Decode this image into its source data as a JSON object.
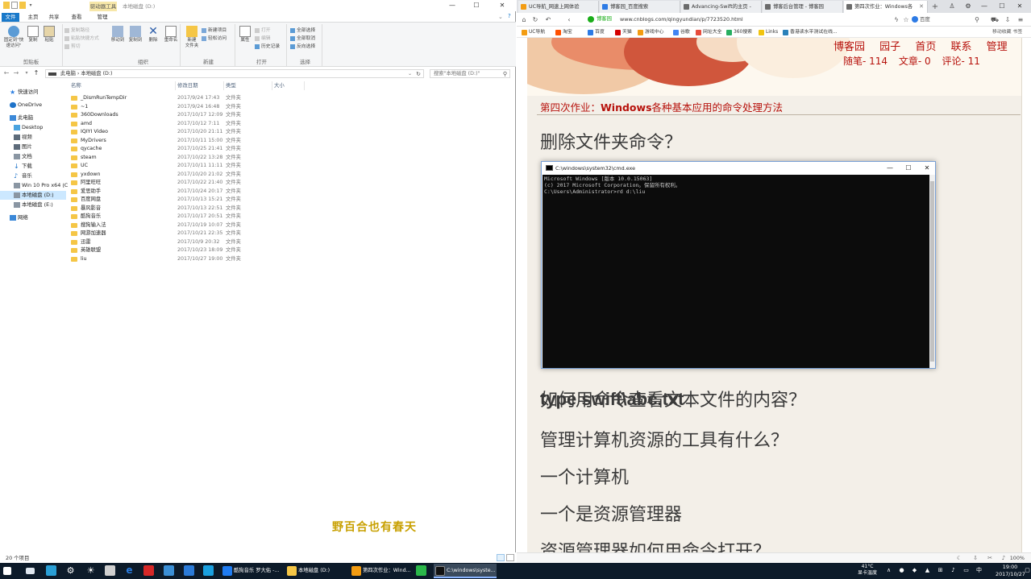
{
  "explorer": {
    "context_tab": "驱动器工具",
    "title": "本地磁盘 (D:)",
    "ribbon_tabs": [
      "文件",
      "主页",
      "共享",
      "查看",
      "管理"
    ],
    "ribbon": {
      "pin_label": "固定到\"快速访问\"",
      "copy_label": "复制",
      "paste_label": "粘贴",
      "copy_path": "复制路径",
      "paste_shortcut": "粘贴快捷方式",
      "cut": "剪切",
      "clipboard_group": "剪贴板",
      "move_to": "移动到",
      "copy_to": "复制到",
      "delete": "删除",
      "rename": "重命名",
      "organize_group": "组织",
      "new_folder": "新建\n文件夹",
      "new_item": "新建项目",
      "easy_access": "轻松访问",
      "new_group": "新建",
      "properties": "属性",
      "open": "打开",
      "edit": "编辑",
      "history": "历史记录",
      "open_group": "打开",
      "select_all": "全部选择",
      "select_none": "全部取消",
      "invert": "反向选择",
      "select_group": "选择"
    },
    "address": {
      "crumbs": "此电脑 › 本地磁盘 (D:)",
      "search_placeholder": "搜索\"本地磁盘 (D:)\""
    },
    "nav": {
      "quick_access": "快速访问",
      "onedrive": "OneDrive",
      "this_pc": "此电脑",
      "desktop": "Desktop",
      "videos": "视频",
      "pictures": "图片",
      "documents": "文档",
      "downloads": "下载",
      "music": "音乐",
      "drive_c": "Win 10 Pro x64 (C",
      "drive_d": "本地磁盘 (D:)",
      "drive_e": "本地磁盘 (E:)",
      "network": "网络"
    },
    "columns": [
      "名称",
      "修改日期",
      "类型",
      "大小"
    ],
    "files": [
      {
        "name": "_DismRunTempDir",
        "date": "2017/9/24 17:43",
        "type": "文件夹"
      },
      {
        "name": "~1",
        "date": "2017/9/24 16:48",
        "type": "文件夹"
      },
      {
        "name": "360Downloads",
        "date": "2017/10/17 12:09",
        "type": "文件夹"
      },
      {
        "name": "amd",
        "date": "2017/10/12 7:11",
        "type": "文件夹"
      },
      {
        "name": "IQIYI Video",
        "date": "2017/10/20 21:11",
        "type": "文件夹"
      },
      {
        "name": "MyDrivers",
        "date": "2017/10/11 15:00",
        "type": "文件夹"
      },
      {
        "name": "qycache",
        "date": "2017/10/25 21:41",
        "type": "文件夹"
      },
      {
        "name": "steam",
        "date": "2017/10/22 13:28",
        "type": "文件夹"
      },
      {
        "name": "UC",
        "date": "2017/10/11 11:11",
        "type": "文件夹"
      },
      {
        "name": "yxdown",
        "date": "2017/10/20 21:02",
        "type": "文件夹"
      },
      {
        "name": "阿里旺旺",
        "date": "2017/10/22 21:40",
        "type": "文件夹"
      },
      {
        "name": "爱思助手",
        "date": "2017/10/24 20:17",
        "type": "文件夹"
      },
      {
        "name": "百度网盘",
        "date": "2017/10/13 15:21",
        "type": "文件夹"
      },
      {
        "name": "暴风影音",
        "date": "2017/10/13 22:51",
        "type": "文件夹"
      },
      {
        "name": "酷狗音乐",
        "date": "2017/10/17 20:51",
        "type": "文件夹"
      },
      {
        "name": "搜狗输入法",
        "date": "2017/10/19 10:07",
        "type": "文件夹"
      },
      {
        "name": "网游加速器",
        "date": "2017/10/21 22:35",
        "type": "文件夹"
      },
      {
        "name": "迅雷",
        "date": "2017/10/9 20:32",
        "type": "文件夹"
      },
      {
        "name": "英雄联盟",
        "date": "2017/10/23 18:09",
        "type": "文件夹"
      },
      {
        "name": "liu",
        "date": "2017/10/27 19:00",
        "type": "文件夹"
      }
    ],
    "status": "20 个项目",
    "watermark": "野百合也有春天"
  },
  "browser": {
    "tabs": [
      {
        "label": "UC导航_网速上网体验",
        "color": "#f39c12"
      },
      {
        "label": "博客园_百度搜索",
        "color": "#2d7be5"
      },
      {
        "label": "Advancing-Swift的主页 -",
        "color": "#6b6b6b"
      },
      {
        "label": "博客后台管理 - 博客园",
        "color": "#6b6b6b"
      },
      {
        "label": "第四次作业：Windows各",
        "color": "#6b6b6b"
      }
    ],
    "url_secure": "博客园",
    "url": "www.cnblogs.com/qingyundian/p/7723520.html",
    "search_engine": "百度",
    "bookmarks": [
      {
        "label": "UC导航",
        "color": "#f39c12"
      },
      {
        "label": "淘宝",
        "color": "#ff5000"
      },
      {
        "label": "百度",
        "color": "#2d7be5"
      },
      {
        "label": "天猫",
        "color": "#d40000"
      },
      {
        "label": "游戏中心",
        "color": "#f39c12"
      },
      {
        "label": "谷歌",
        "color": "#4285f4"
      },
      {
        "label": "网址大全",
        "color": "#e74c3c"
      },
      {
        "label": "360搜索",
        "color": "#27ae60"
      },
      {
        "label": "Links",
        "color": "#f1c40f"
      },
      {
        "label": "香港读水平测试在线...",
        "color": "#2980b9"
      }
    ],
    "bookmark_overflow": "移动收藏 书签",
    "page": {
      "nav_items": [
        "博客园",
        "园子",
        "首页",
        "联系",
        "管理"
      ],
      "stats": [
        "随笔- 114",
        "文章- 0",
        "评论- 11"
      ],
      "post_title_prefix": "第四次作业：",
      "post_title_bold": "Windows",
      "post_title_suffix": "各种基本应用的命令处理方法",
      "lines": [
        "删除文件夹命令？",
        "如何用命令查看文本文件的内容？",
        "type swift\\abc.txt",
        "管理计算机资源的工具有什么？",
        "一个计算机",
        "一个是资源管理器",
        "资源管理器如何用命令打开？"
      ]
    },
    "zoom": "100%"
  },
  "cmd": {
    "title": "C:\\windows\\system32\\cmd.exe",
    "lines": [
      "Microsoft Windows [版本 10.0.15063]",
      "(c) 2017 Microsoft Corporation。保留所有权利。",
      "",
      "C:\\Users\\Administrator>rd d:\\liu"
    ]
  },
  "taskbar": {
    "apps": [
      {
        "label": "酷狗音乐 罗大佑 -...",
        "color": "#1f7cf2"
      },
      {
        "label": "本地磁盘 (D:)",
        "color": "#f5c646"
      },
      {
        "label": "第四次作业：Wind...",
        "color": "#f39c12"
      },
      {
        "label": "C:\\windows\\syste...",
        "color": "#111111"
      }
    ],
    "temp": "41°C",
    "temp_label": "显卡温度",
    "time": "19:00",
    "date": "2017/10/27"
  }
}
